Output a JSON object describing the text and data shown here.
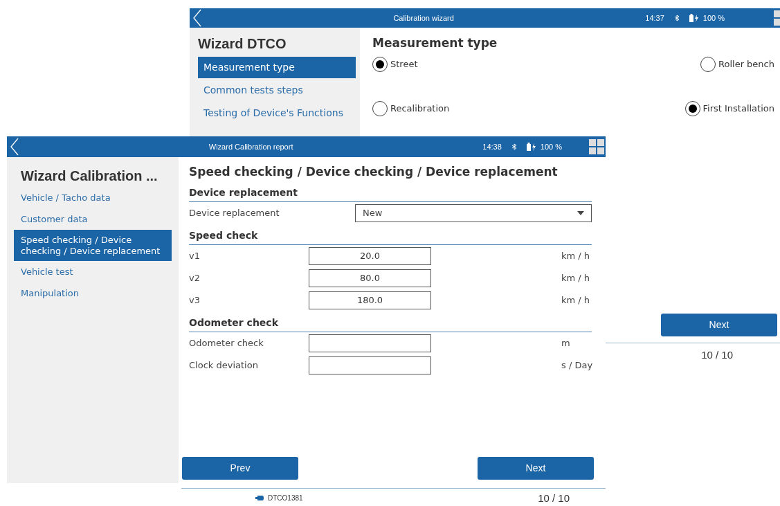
{
  "back_window": {
    "title": "Calibration wizard",
    "time": "14:37",
    "battery": "100 %",
    "sidebar": {
      "title": "Wizard DTCO",
      "items": [
        {
          "label": "Measurement type",
          "selected": true
        },
        {
          "label": "Common tests steps",
          "selected": false
        },
        {
          "label": "Testing of Device's Functions",
          "selected": false
        }
      ]
    },
    "heading": "Measurement type",
    "options": [
      {
        "label": "Street",
        "selected": true
      },
      {
        "label": "Roller bench",
        "selected": false
      },
      {
        "label": "Recalibration",
        "selected": false
      },
      {
        "label": "First Installation",
        "selected": true
      }
    ],
    "next_button": "Next",
    "page": "10 / 10"
  },
  "front_window": {
    "title": "Wizard Calibration report",
    "time": "14:38",
    "battery": "100 %",
    "sidebar": {
      "title": "Wizard Calibration ...",
      "items": [
        {
          "label": "Vehicle / Tacho data",
          "selected": false
        },
        {
          "label": "Customer data",
          "selected": false
        },
        {
          "label": "Speed checking / Device checking / Device replacement",
          "selected": true
        },
        {
          "label": "Vehicle test",
          "selected": false
        },
        {
          "label": "Manipulation",
          "selected": false
        }
      ]
    },
    "heading": "Speed checking / Device checking / Device replacement",
    "sections": [
      {
        "title": "Device replacement",
        "rows": [
          {
            "kind": "select",
            "label": "Device replacement",
            "value": "New"
          }
        ]
      },
      {
        "title": "Speed check",
        "rows": [
          {
            "kind": "input",
            "label": "v1",
            "value": "20.0",
            "unit": "km / h"
          },
          {
            "kind": "input",
            "label": "v2",
            "value": "80.0",
            "unit": "km / h"
          },
          {
            "kind": "input",
            "label": "v3",
            "value": "180.0",
            "unit": "km / h"
          }
        ]
      },
      {
        "title": "Odometer check",
        "rows": [
          {
            "kind": "input",
            "label": "Odometer check",
            "value": "",
            "unit": "m"
          },
          {
            "kind": "input",
            "label": "Clock deviation",
            "value": "",
            "unit": "s / Day"
          }
        ]
      }
    ],
    "prev_button": "Prev",
    "next_button": "Next",
    "device": "DTCO1381",
    "page": "10 / 10"
  }
}
